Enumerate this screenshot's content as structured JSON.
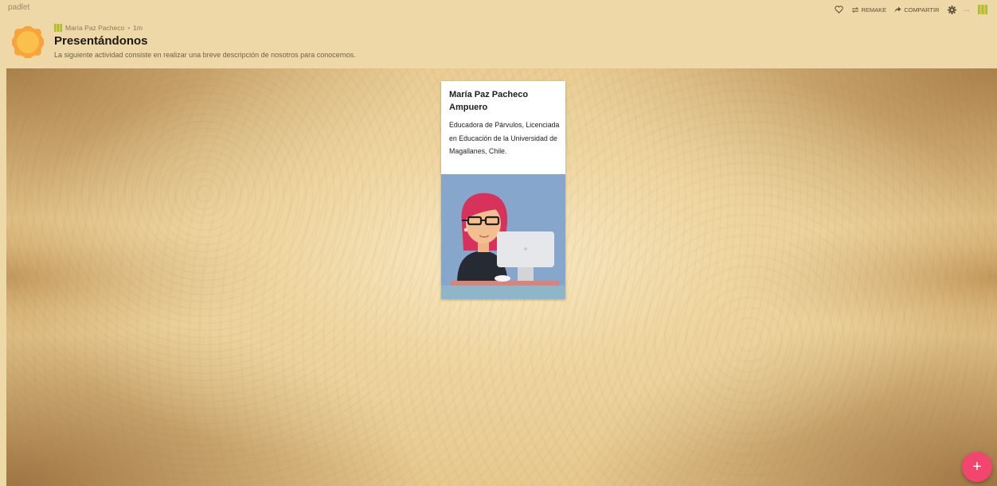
{
  "app": {
    "brand": "padlet"
  },
  "header": {
    "author": "María Paz Pacheco",
    "time_ago": "1m",
    "separator": "•",
    "title": "Presentándonos",
    "description": "La siguiente actividad consiste en realizar una breve descripción de nosotros para conocernos."
  },
  "toolbar": {
    "remake_label": "REMAKE",
    "share_label": "COMPARTIR",
    "more_label": "···"
  },
  "post": {
    "title": "María Paz Pacheco Ampuero",
    "body": "Educadora de Párvulos, Licenciada en Educación de la Universidad de Magallanes, Chile."
  },
  "fab": {
    "label": "+"
  },
  "colors": {
    "header_bg": "#eed8a7",
    "accent": "#f2466f",
    "avatar": "#f7b942"
  }
}
